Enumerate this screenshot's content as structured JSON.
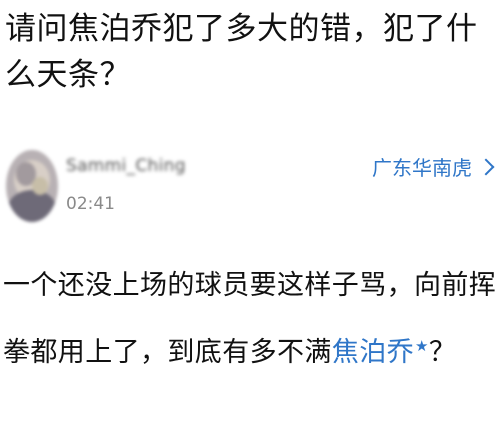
{
  "question": {
    "title": "请问焦泊乔犯了多大的错，犯了什么天条？"
  },
  "author": {
    "username": "Sammi_Ching",
    "time": "02:41",
    "avatar_icon": "avatar-image"
  },
  "topic": {
    "label": "广东华南虎",
    "icon": "chevron-right-icon",
    "color": "#2f76c8"
  },
  "answer": {
    "text_before": "一个还没上场的球员要这样子骂，向前挥拳都用上了，到底有多不满",
    "mention": "焦泊乔",
    "mention_icon": "star-icon",
    "text_after": "？"
  }
}
